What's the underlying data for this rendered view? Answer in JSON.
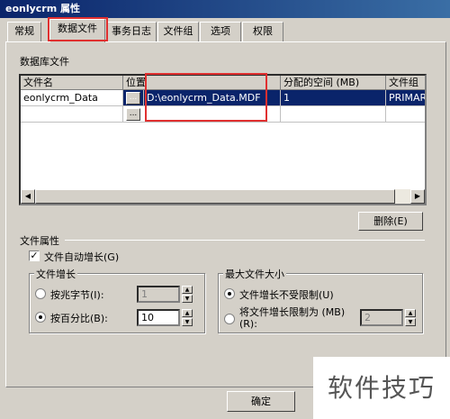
{
  "window": {
    "title": "eonlycrm 属性"
  },
  "tabs": [
    {
      "label": "常规"
    },
    {
      "label": "数据文件"
    },
    {
      "label": "事务日志"
    },
    {
      "label": "文件组"
    },
    {
      "label": "选项"
    },
    {
      "label": "权限"
    }
  ],
  "db_files": {
    "section_label": "数据库文件",
    "columns": [
      "文件名",
      "位置",
      "分配的空间 (MB)",
      "文件组"
    ],
    "rows": [
      {
        "name": "eonlycrm_Data",
        "location": "D:\\eonlycrm_Data.MDF",
        "size": "1",
        "filegroup": "PRIMAR"
      }
    ],
    "browse_label": "...",
    "delete_label": "删除(E)"
  },
  "file_props": {
    "section_label": "文件属性",
    "auto_grow_label": "文件自动增长(G)",
    "auto_grow_checked": true,
    "growth": {
      "title": "文件增长",
      "by_mb_label": "按兆字节(I):",
      "by_mb_value": "1",
      "by_percent_label": "按百分比(B):",
      "by_percent_value": "10",
      "selected": "percent"
    },
    "max_size": {
      "title": "最大文件大小",
      "unlimited_label": "文件增长不受限制(U)",
      "limit_label": "将文件增长限制为 (MB)(R):",
      "limit_value": "2",
      "selected": "unlimited"
    }
  },
  "footer": {
    "ok_label": "确定"
  },
  "watermark": {
    "text": "软件技巧"
  },
  "colors": {
    "selection": "#0a246a",
    "highlight": "#e03030",
    "title_gradient_end": "#3a6ea5"
  }
}
